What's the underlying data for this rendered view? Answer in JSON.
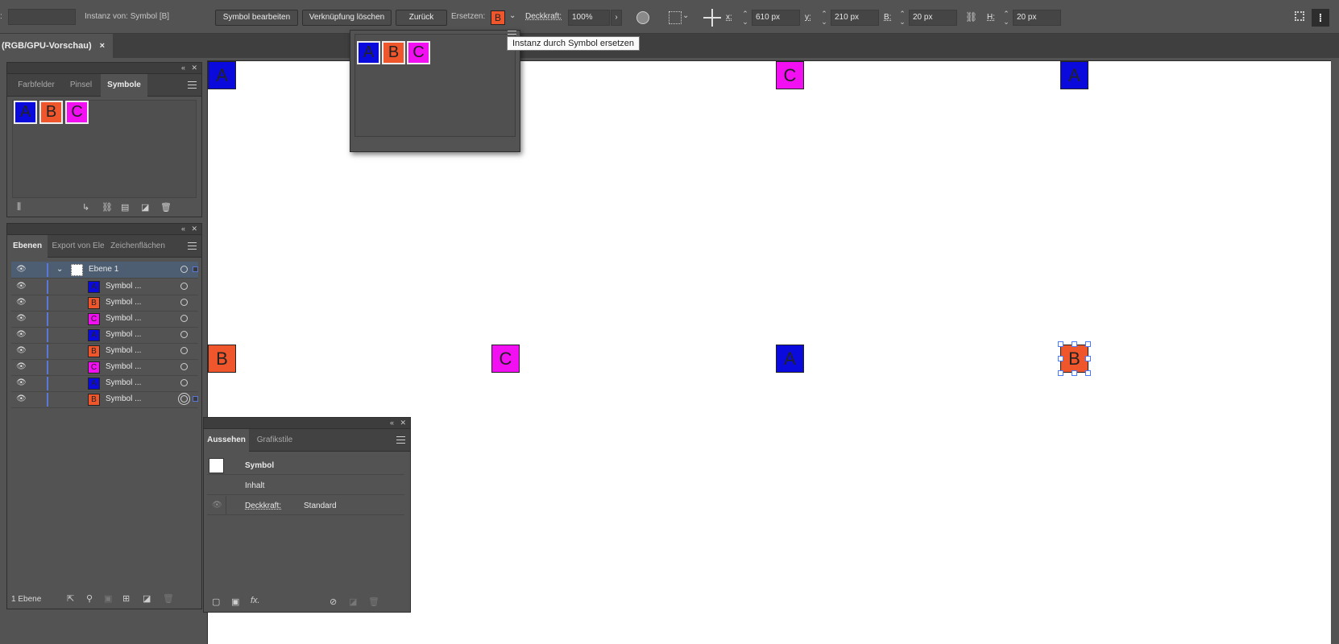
{
  "controlbar": {
    "instance_label": "Instanz von: Symbol [B]",
    "edit_symbol": "Symbol bearbeiten",
    "break_link": "Verknüpfung löschen",
    "reset": "Zurück",
    "replace_label": "Ersetzen:",
    "replace_value": "B",
    "opacity_label": "Deckkraft:",
    "opacity_value": "100%",
    "x_label": "x:",
    "x_value": "610 px",
    "y_label": "y:",
    "y_value": "210 px",
    "w_label": "B:",
    "w_value": "20 px",
    "h_label": "H:",
    "h_value": "20 px"
  },
  "doc_tab": {
    "title": "(RGB/GPU-Vorschau)",
    "close": "×"
  },
  "tooltip": "Instanz durch Symbol ersetzen",
  "replace_popup": {
    "symbols": [
      "A",
      "B",
      "C"
    ]
  },
  "symbols_panel": {
    "tabs": [
      "Farbfelder",
      "Pinsel",
      "Symbole"
    ],
    "active_tab": "Symbole",
    "symbols": [
      "A",
      "B",
      "C"
    ]
  },
  "layers_panel": {
    "tabs": [
      "Ebenen",
      "Export von Ele",
      "Zeichenflächen"
    ],
    "layer_name": "Ebene 1",
    "rows": [
      {
        "symbol": "A",
        "label": "Symbol ..."
      },
      {
        "symbol": "B",
        "label": "Symbol ..."
      },
      {
        "symbol": "C",
        "label": "Symbol ..."
      },
      {
        "symbol": "A",
        "label": "Symbol ..."
      },
      {
        "symbol": "B",
        "label": "Symbol ..."
      },
      {
        "symbol": "C",
        "label": "Symbol ..."
      },
      {
        "symbol": "A",
        "label": "Symbol ..."
      },
      {
        "symbol": "B",
        "label": "Symbol ..."
      }
    ],
    "footer_count": "1 Ebene"
  },
  "appearance_panel": {
    "tabs": [
      "Aussehen",
      "Grafikstile"
    ],
    "title_row": "Symbol",
    "content_row": "Inhalt",
    "opacity_label": "Deckkraft:",
    "opacity_value": "Standard"
  },
  "canvas_symbols_row1": [
    "A",
    "C",
    "A"
  ],
  "canvas_symbols_row2": [
    "B",
    "C",
    "A",
    "B"
  ],
  "colors": {
    "A": "#0a0adc",
    "B": "#f0562b",
    "C": "#f20ff2",
    "selection": "#4a78ff"
  }
}
